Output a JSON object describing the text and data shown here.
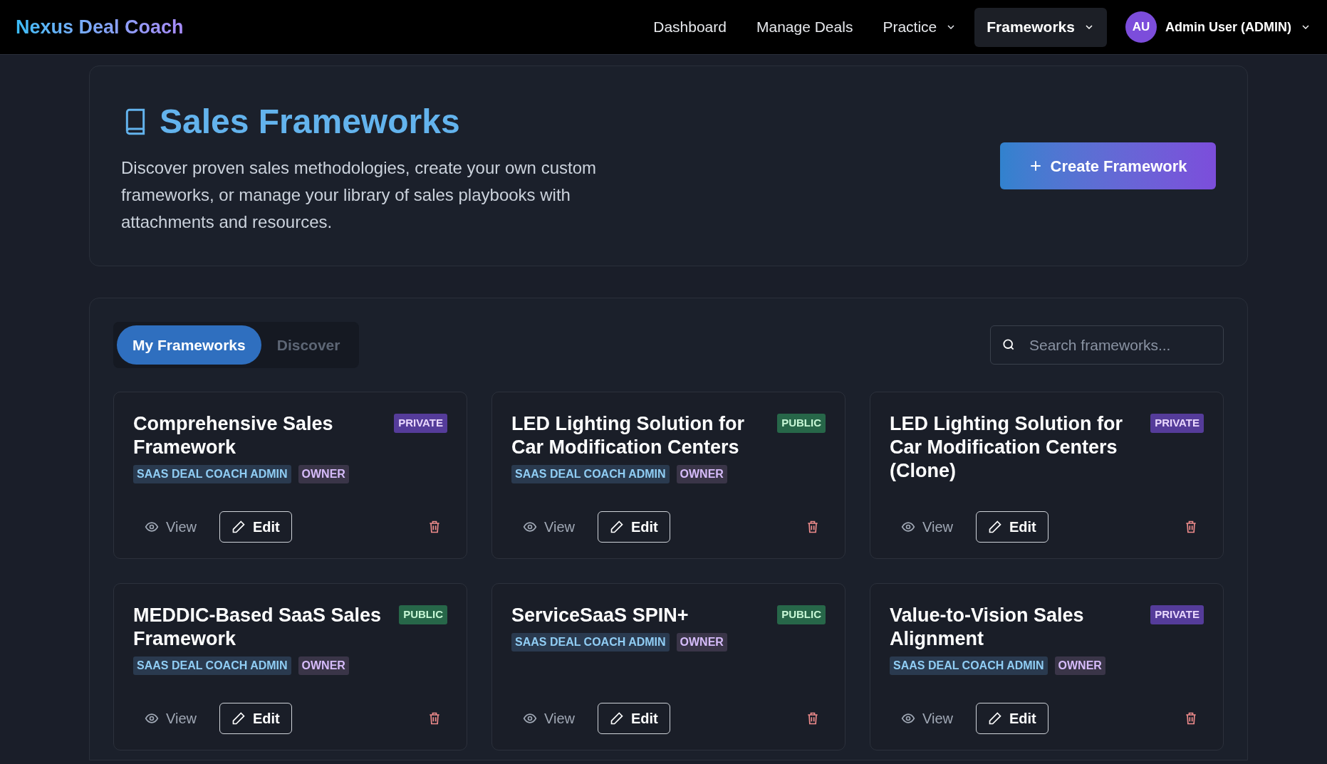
{
  "nav": {
    "logo": "Nexus Deal Coach",
    "links": [
      {
        "label": "Dashboard",
        "dropdown": false,
        "selected": false
      },
      {
        "label": "Manage Deals",
        "dropdown": false,
        "selected": false
      },
      {
        "label": "Practice",
        "dropdown": true,
        "selected": false
      },
      {
        "label": "Frameworks",
        "dropdown": true,
        "selected": true
      }
    ],
    "user": {
      "initials": "AU",
      "name": "Admin User (ADMIN)"
    }
  },
  "header": {
    "title": "Sales Frameworks",
    "description": "Discover proven sales methodologies, create your own custom frameworks, or manage your library of sales playbooks with attachments and resources.",
    "button": "Create Framework"
  },
  "tabs": [
    {
      "label": "My Frameworks",
      "selected": true
    },
    {
      "label": "Discover",
      "selected": false
    }
  ],
  "search": {
    "placeholder": "Search frameworks..."
  },
  "cards": [
    {
      "title": "Comprehensive Sales Framework",
      "visibility": "PRIVATE",
      "kind": "private",
      "tags": [
        "SAAS DEAL COACH ADMIN",
        "OWNER"
      ],
      "view": "View",
      "edit": "Edit"
    },
    {
      "title": "LED Lighting Solution for Car Modification Centers",
      "visibility": "PUBLIC",
      "kind": "public",
      "tags": [
        "SAAS DEAL COACH ADMIN",
        "OWNER"
      ],
      "view": "View",
      "edit": "Edit"
    },
    {
      "title": "LED Lighting Solution for Car Modification Centers (Clone)",
      "visibility": "PRIVATE",
      "kind": "private",
      "view": "View",
      "edit": "Edit"
    },
    {
      "title": "MEDDIC-Based SaaS Sales Framework",
      "visibility": "PUBLIC",
      "kind": "public",
      "tags": [
        "SAAS DEAL COACH ADMIN",
        "OWNER"
      ],
      "view": "View",
      "edit": "Edit"
    },
    {
      "title": "ServiceSaaS SPIN+",
      "visibility": "PUBLIC",
      "kind": "public",
      "tags": [
        "SAAS DEAL COACH ADMIN",
        "OWNER"
      ],
      "view": "View",
      "edit": "Edit"
    },
    {
      "title": "Value-to-Vision Sales Alignment",
      "visibility": "PRIVATE",
      "kind": "private",
      "tags": [
        "SAAS DEAL COACH ADMIN",
        "OWNER"
      ],
      "view": "View",
      "edit": "Edit"
    }
  ]
}
